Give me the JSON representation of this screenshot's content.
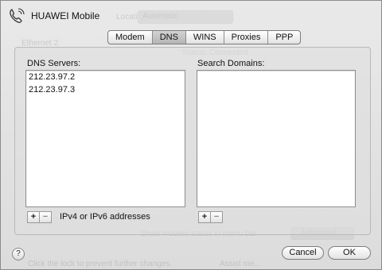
{
  "window": {
    "title": "HUAWEI Mobile"
  },
  "tabs": [
    {
      "label": "Modem",
      "active": false
    },
    {
      "label": "DNS",
      "active": true
    },
    {
      "label": "WINS",
      "active": false
    },
    {
      "label": "Proxies",
      "active": false
    },
    {
      "label": "PPP",
      "active": false
    }
  ],
  "dns": {
    "servers_label": "DNS Servers:",
    "servers": [
      "212.23.97.2",
      "212.23.97.3"
    ],
    "search_label": "Search Domains:",
    "search_domains": [],
    "hint": "IPv4 or IPv6 addresses",
    "add_symbol": "+",
    "remove_symbol": "−"
  },
  "buttons": {
    "help": "?",
    "cancel": "Cancel",
    "ok": "OK"
  },
  "background_window": {
    "location_label": "Location:",
    "location_value": "Automatic",
    "service_1": "Ethernet 2",
    "status_label": "Status:",
    "status_value": "Connected",
    "show_modem_status": "Show modem status in menu bar",
    "advanced_label": "Advanced...",
    "lock_text": "Click the lock to prevent further changes.",
    "assist_label": "Assist me..."
  },
  "icons": {
    "window_icon": "phone-icon",
    "help_icon": "help-icon"
  }
}
